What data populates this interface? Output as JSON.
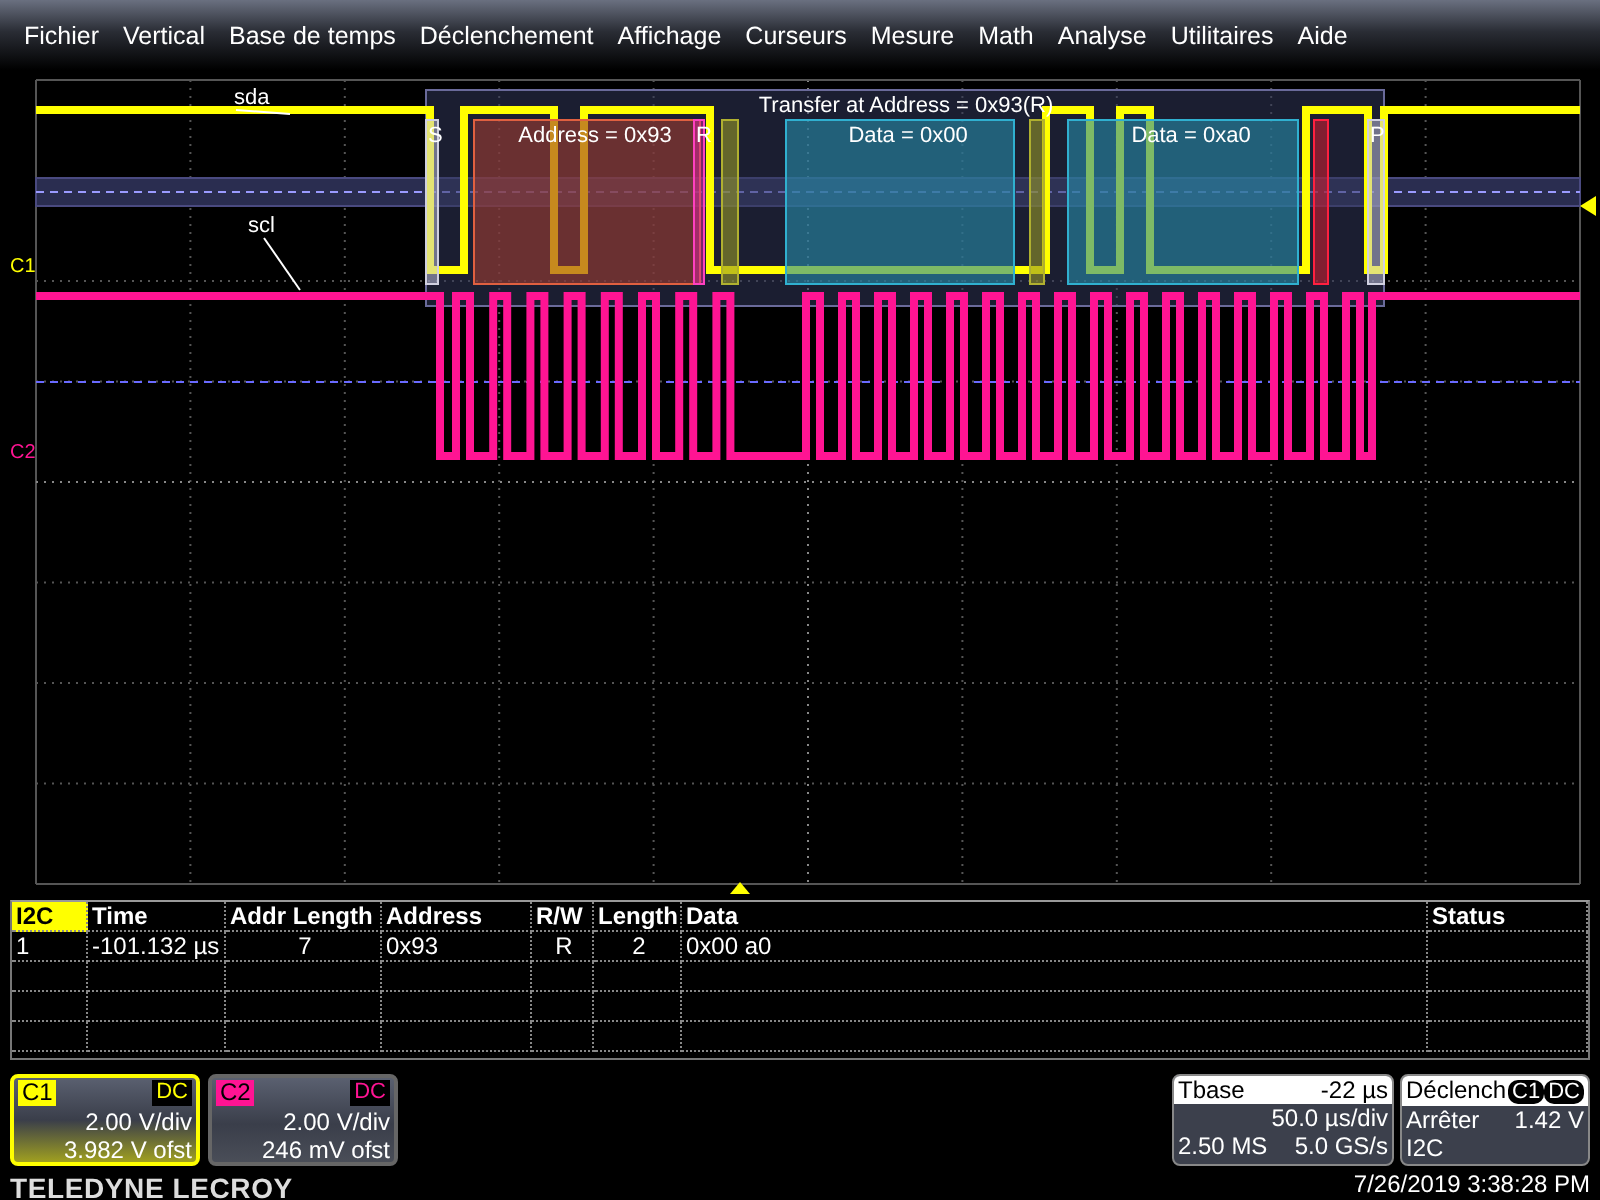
{
  "menu": [
    "Fichier",
    "Vertical",
    "Base de temps",
    "Déclenchement",
    "Affichage",
    "Curseurs",
    "Mesure",
    "Math",
    "Analyse",
    "Utilitaires",
    "Aide"
  ],
  "traces": [
    {
      "label": "sda"
    },
    {
      "label": "scl"
    }
  ],
  "channel_markers": [
    {
      "label": "C1",
      "color": "#ffff00"
    },
    {
      "label": "C2",
      "color": "#ff1493"
    }
  ],
  "decode": {
    "title": "Transfer at Address = 0x93(R)",
    "fields": [
      {
        "kind": "start",
        "label": "S"
      },
      {
        "kind": "address",
        "label": "Address = 0x93"
      },
      {
        "kind": "rw",
        "label": "R"
      },
      {
        "kind": "ack"
      },
      {
        "kind": "data",
        "label": "Data = 0x00"
      },
      {
        "kind": "ack"
      },
      {
        "kind": "data",
        "label": "Data = 0xa0"
      },
      {
        "kind": "nack"
      },
      {
        "kind": "stop",
        "label": "P"
      }
    ]
  },
  "table": {
    "columns": [
      "I2C",
      "Time",
      "Addr Length",
      "Address",
      "R/W",
      "Length",
      "Data",
      "Status"
    ],
    "rows": [
      [
        "1",
        "-101.132 µs",
        "7",
        "0x93",
        "R",
        "2",
        "0x00 a0"
      ]
    ]
  },
  "channels": [
    {
      "name": "C1",
      "coupling": "DC",
      "scale": "2.00 V/div",
      "offset": "3.982 V ofst",
      "color": "#ffff00",
      "selected": true
    },
    {
      "name": "C2",
      "coupling": "DC",
      "scale": "2.00 V/div",
      "offset": "246 mV ofst",
      "color": "#ff1493",
      "selected": false
    }
  ],
  "timebase": {
    "title": "Tbase",
    "delay": "-22 µs",
    "scale": "50.0 µs/div",
    "samples": "2.50 MS",
    "rate": "5.0 GS/s"
  },
  "trigger": {
    "title": "Déclench",
    "source": "C1",
    "coupling": "DC",
    "mode": "Arrêter",
    "level": "1.42 V",
    "type": "I2C"
  },
  "logo": "TELEDYNE LECROY",
  "datetime": "7/26/2019 3:38:28 PM"
}
